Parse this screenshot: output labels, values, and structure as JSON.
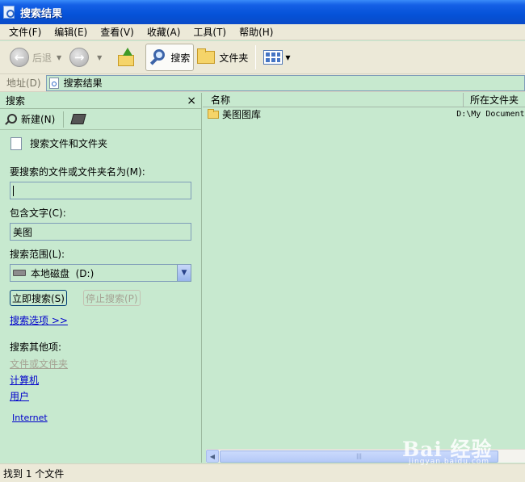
{
  "window": {
    "title": "搜索结果"
  },
  "menu": [
    "文件(F)",
    "编辑(E)",
    "查看(V)",
    "收藏(A)",
    "工具(T)",
    "帮助(H)"
  ],
  "toolbar": {
    "back_label": "后退",
    "search_label": "搜索",
    "folders_label": "文件夹"
  },
  "address": {
    "label": "地址(D)",
    "value": "搜索结果"
  },
  "search_panel": {
    "title": "搜索",
    "close": "×",
    "new_label": "新建(N)",
    "section_title": "搜索文件和文件夹",
    "name_label": "要搜索的文件或文件夹名为(M):",
    "name_value": "",
    "text_label": "包含文字(C):",
    "text_value": "美图",
    "scope_label": "搜索范围(L):",
    "scope_value": "本地磁盘  (D:)",
    "search_now": "立即搜索(S)",
    "stop_search": "停止搜索(P)",
    "options_link": "搜索选项 >>",
    "also_label": "搜索其他项:",
    "also_links": [
      "文件或文件夹",
      "计算机",
      "用户",
      "Internet"
    ]
  },
  "results": {
    "columns": [
      "名称",
      "所在文件夹"
    ],
    "rows": [
      {
        "name": "美图图库",
        "folder": "D:\\My Documents"
      }
    ]
  },
  "statusbar": {
    "text": "找到 1 个文件"
  },
  "watermark": {
    "main": "Bai 经验",
    "sub": "jingyan.baidu.com"
  }
}
